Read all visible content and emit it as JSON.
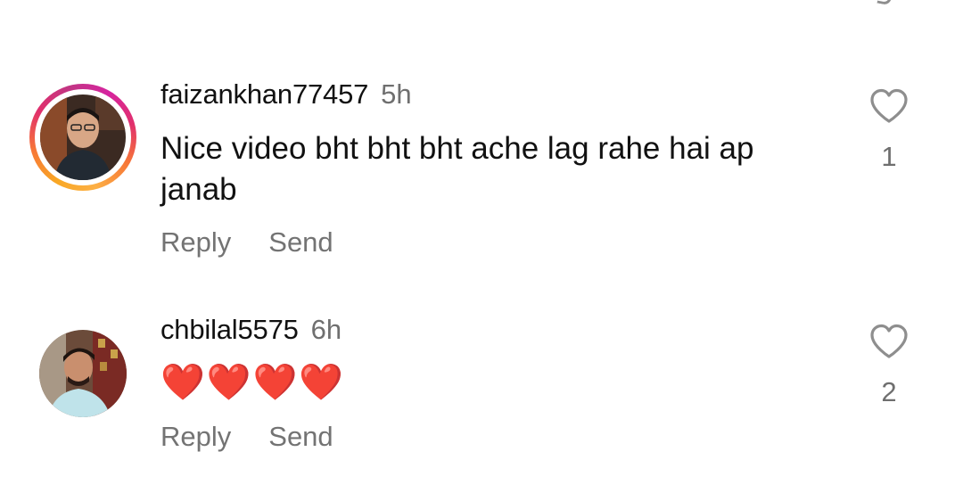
{
  "comments": [
    {
      "username": "faizankhan77457",
      "time": "5h",
      "text": "Nice video bht bht bht ache lag rahe hai ap janab",
      "like_count": "1",
      "reply_label": "Reply",
      "send_label": "Send",
      "has_story_ring": true
    },
    {
      "username": "chbilal5575",
      "time": "6h",
      "text": "❤️❤️❤️❤️",
      "like_count": "2",
      "reply_label": "Reply",
      "send_label": "Send",
      "has_story_ring": false
    }
  ],
  "icons": {
    "like": "heart-outline-icon",
    "top_edge": "partial-icon"
  },
  "colors": {
    "text": "#111111",
    "muted": "#737373",
    "heart_emoji": "#e0292e",
    "story_ring_start": "#f9a825",
    "story_ring_end": "#d6249f"
  }
}
